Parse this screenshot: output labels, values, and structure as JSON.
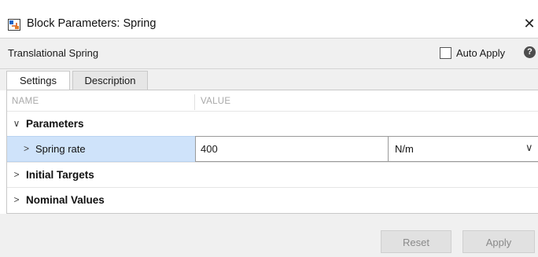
{
  "window": {
    "title": "Block Parameters: Spring",
    "close_glyph": "✕"
  },
  "header": {
    "block_type": "Translational Spring",
    "auto_apply_label": "Auto Apply",
    "auto_apply_checked": false,
    "help_glyph": "?"
  },
  "tabs": [
    {
      "label": "Settings",
      "active": true
    },
    {
      "label": "Description",
      "active": false
    }
  ],
  "table": {
    "columns": [
      "NAME",
      "VALUE"
    ],
    "groups": [
      {
        "label": "Parameters",
        "expanded": true,
        "params": [
          {
            "label": "Spring rate",
            "value": "400",
            "unit": "N/m"
          }
        ]
      },
      {
        "label": "Initial Targets",
        "expanded": false
      },
      {
        "label": "Nominal Values",
        "expanded": false
      }
    ]
  },
  "footer": {
    "reset_label": "Reset",
    "apply_label": "Apply"
  },
  "icons": {
    "expanded": "∨",
    "collapsed": ">",
    "dropdown": "∨"
  },
  "colors": {
    "selected_cell": "#cfe3fa",
    "disabled_text": "#8a8a8a",
    "panel_bg": "#f0f0f0"
  }
}
